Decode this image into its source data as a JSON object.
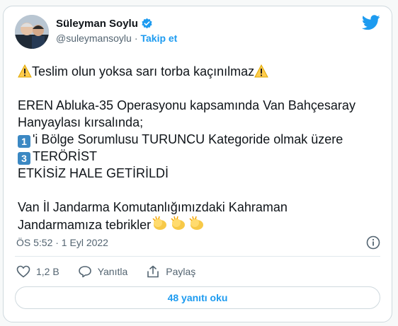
{
  "author": {
    "name": "Süleyman Soylu",
    "handle": "@suleymansoylu",
    "separator": "·",
    "follow_label": "Takip et"
  },
  "tweet": {
    "line1": "Teslim olun yoksa sarı torba kaçınılmaz",
    "line2": "EREN Abluka-35 Operasyonu kapsamında Van Bahçesaray",
    "line3": "Hanyaylası kırsalında;",
    "badge1": "1",
    "line4": "'i Bölge Sorumlusu TURUNCU Kategoride olmak üzere",
    "badge2": "3",
    "line5": "TERÖRİST",
    "line6": "ETKİSİZ HALE GETİRİLDİ",
    "line7": "Van İl Jandarma Komutanlığımızdaki Kahraman",
    "line8": "Jandarmamıza tebrikler"
  },
  "timestamp": "ÖS 5:52 · 1 Eyl 2022",
  "actions": {
    "likes": "1,2 B",
    "reply_label": "Yanıtla",
    "share_label": "Paylaş"
  },
  "replies_button": "48 yanıtı oku",
  "colors": {
    "accent": "#1d9bf0",
    "text": "#0f1419",
    "muted": "#536471",
    "border": "#cfd9de",
    "badge": "#3b88c3",
    "clap": "#f7c948"
  }
}
